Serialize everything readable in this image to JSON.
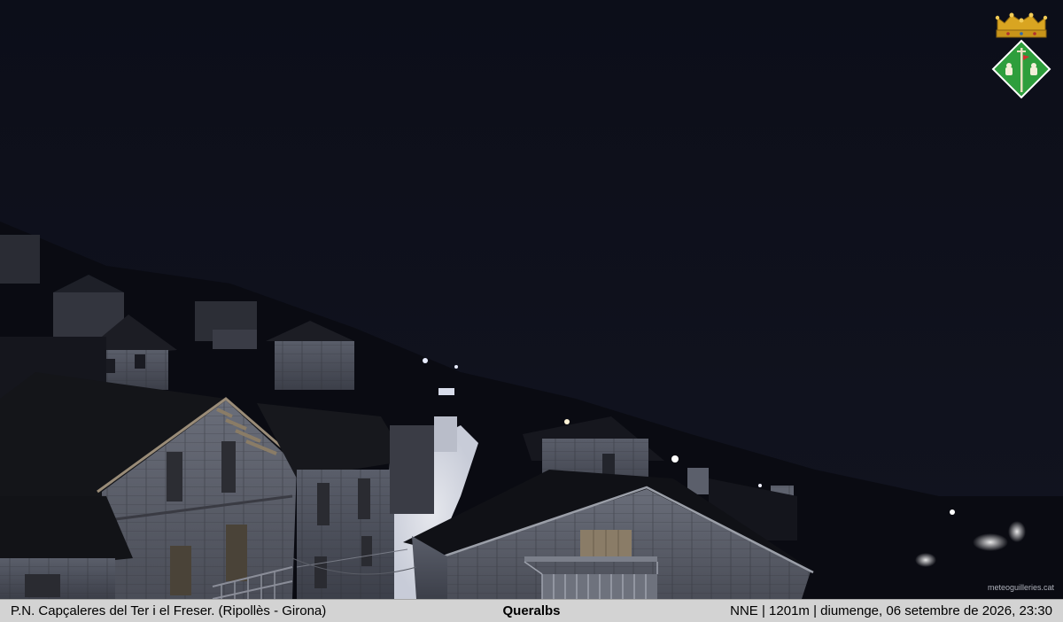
{
  "footer": {
    "location": "P.N. Capçaleres del Ter i el Freser. (Ripollès - Girona)",
    "village": "Queralbs",
    "info": "NNE | 1201m | diumenge, 06 setembre de 2026, 23:30"
  },
  "watermark": "meteoguilleries.cat",
  "icons": {
    "crest": "municipal-coat-of-arms-icon"
  },
  "colors": {
    "sky": "#0d0f1a",
    "footer_bg": "#d3d3d3",
    "crest_green": "#2e9e3c",
    "crest_gold": "#d9a521"
  }
}
